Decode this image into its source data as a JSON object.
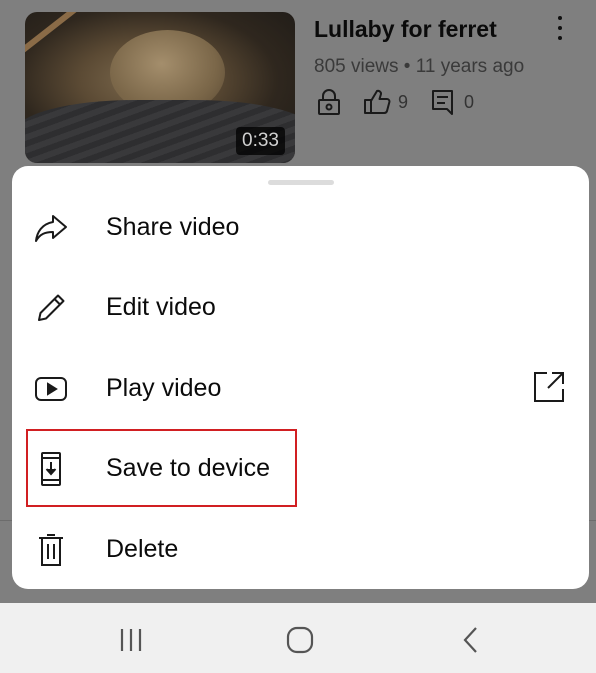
{
  "video": {
    "title": "Lullaby for ferret",
    "meta": "805 views • 11 years ago",
    "duration": "0:33",
    "likes": "9",
    "comments": "0",
    "icons": [
      "lock-icon",
      "thumbs-up-icon",
      "comment-icon",
      "more-vert-icon"
    ]
  },
  "menu": {
    "items": [
      {
        "label": "Share video",
        "icon": "share-icon"
      },
      {
        "label": "Edit video",
        "icon": "pencil-icon"
      },
      {
        "label": "Play video",
        "icon": "play-icon",
        "trailing_icon": "open-external-icon"
      },
      {
        "label": "Save to device",
        "icon": "download-to-device-icon",
        "highlighted": true
      },
      {
        "label": "Delete",
        "icon": "trash-icon"
      }
    ],
    "highlight_color": "#d11f22"
  },
  "navbar": {
    "buttons": [
      "recent-apps-icon",
      "home-icon",
      "back-icon"
    ]
  },
  "colors": {
    "scrim": "#7f7f7f",
    "sheet": "#ffffff",
    "navbar": "#f0f0f0"
  }
}
